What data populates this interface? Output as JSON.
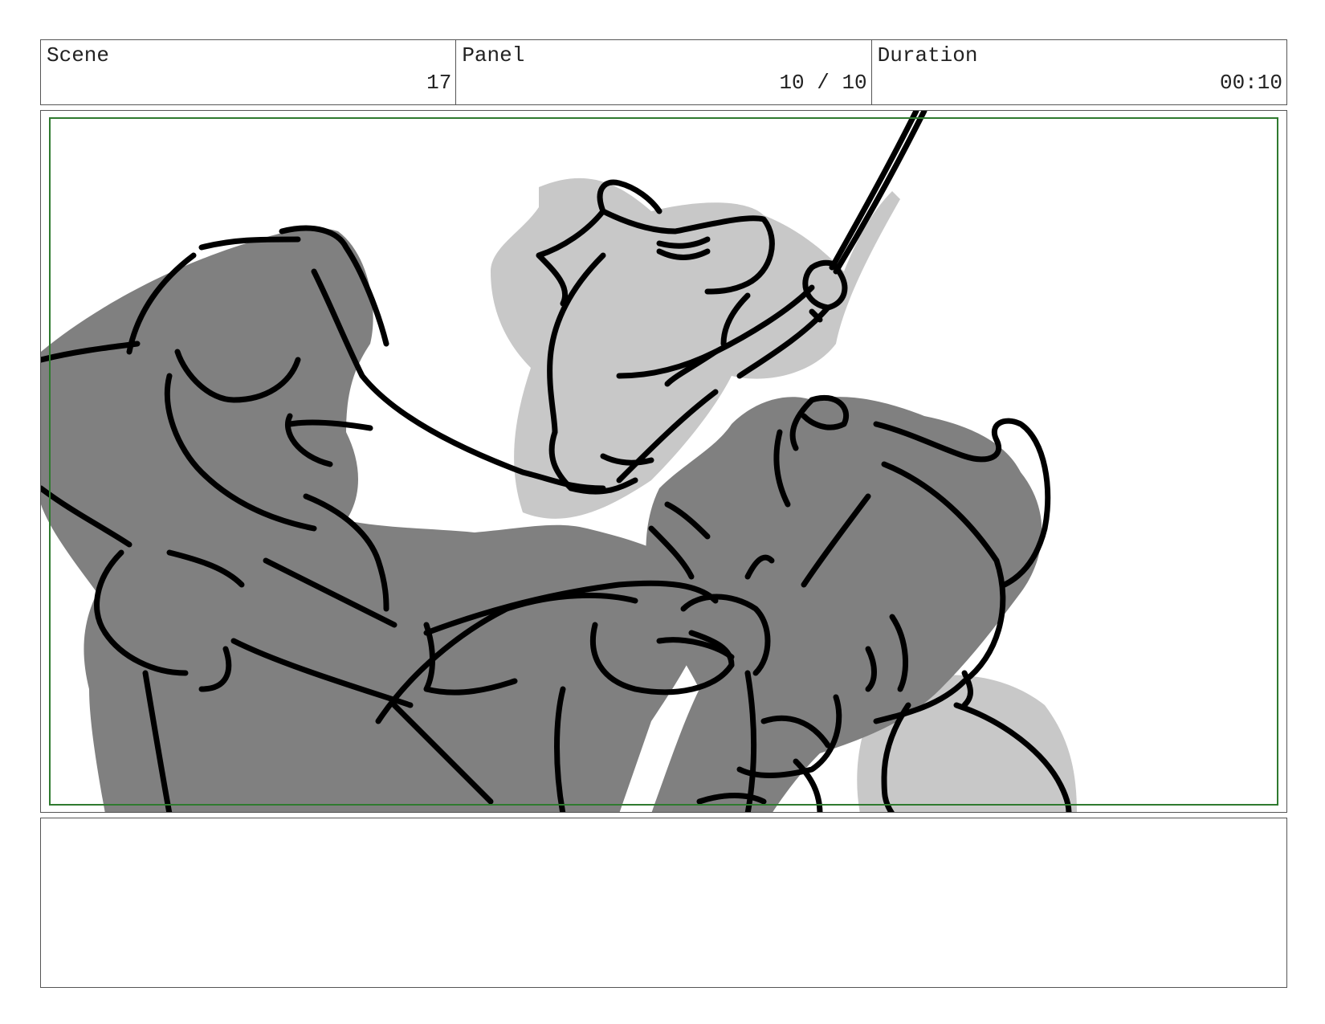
{
  "header": {
    "scene_label": "Scene",
    "scene_value": "17",
    "panel_label": "Panel",
    "panel_value": "10 / 10",
    "duration_label": "Duration",
    "duration_value": "00:10"
  },
  "notes": {
    "text": ""
  },
  "colors": {
    "safe_area_border": "#2f7a2f",
    "dark_fill": "#808080",
    "light_fill": "#c8c8c8",
    "ink": "#000000"
  }
}
